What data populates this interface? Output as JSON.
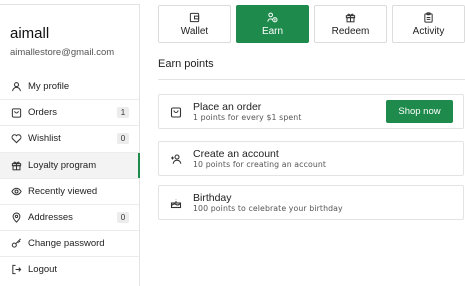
{
  "profile": {
    "name": "aimall",
    "email": "aimallestore@gmail.com"
  },
  "sidebar": {
    "items": [
      {
        "label": "My profile",
        "icon": "user-icon",
        "badge": ""
      },
      {
        "label": "Orders",
        "icon": "bag-icon",
        "badge": "1"
      },
      {
        "label": "Wishlist",
        "icon": "heart-icon",
        "badge": "0"
      },
      {
        "label": "Loyalty program",
        "icon": "gift-icon",
        "badge": "",
        "active": true
      },
      {
        "label": "Recently viewed",
        "icon": "eye-icon",
        "badge": ""
      },
      {
        "label": "Addresses",
        "icon": "pin-icon",
        "badge": "0"
      },
      {
        "label": "Change password",
        "icon": "key-icon",
        "badge": ""
      },
      {
        "label": "Logout",
        "icon": "logout-icon",
        "badge": ""
      }
    ]
  },
  "tabs": [
    {
      "label": "Wallet",
      "icon": "wallet-icon"
    },
    {
      "label": "Earn",
      "icon": "earn-icon",
      "active": true
    },
    {
      "label": "Redeem",
      "icon": "gift-icon"
    },
    {
      "label": "Activity",
      "icon": "clipboard-icon"
    }
  ],
  "section": {
    "title": "Earn points"
  },
  "cards": [
    {
      "title": "Place an order",
      "subtitle": "1 points for every $1 spent",
      "button": "Shop now",
      "icon": "bag-icon"
    },
    {
      "title": "Create an account",
      "subtitle": "10 points for creating an account",
      "icon": "user-plus-icon"
    },
    {
      "title": "Birthday",
      "subtitle": "100 points to celebrate your birthday",
      "icon": "cake-icon"
    }
  ],
  "colors": {
    "accent": "#1e8a4c",
    "border": "#e3e3e3",
    "badge_bg": "#ececec"
  }
}
